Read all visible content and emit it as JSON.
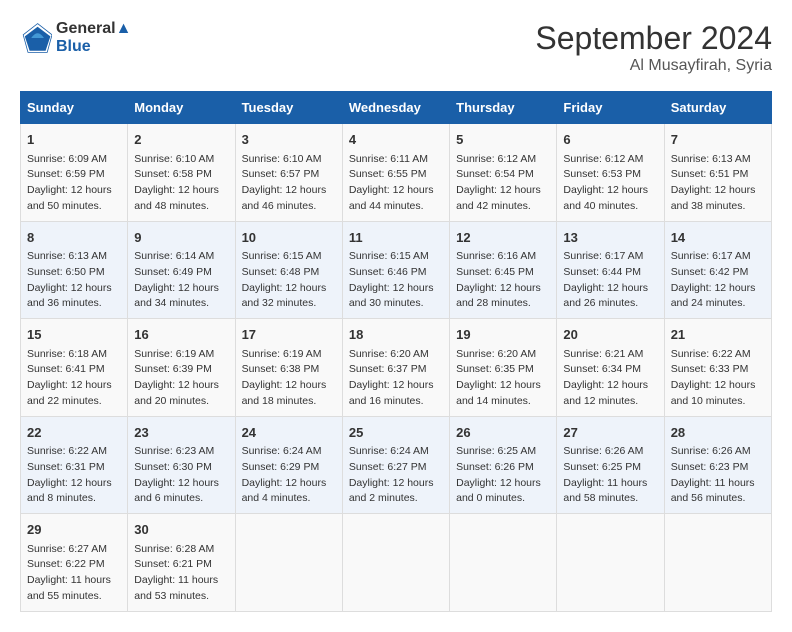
{
  "header": {
    "logo_line1": "General",
    "logo_line2": "Blue",
    "month": "September 2024",
    "location": "Al Musayfirah, Syria"
  },
  "days_of_week": [
    "Sunday",
    "Monday",
    "Tuesday",
    "Wednesday",
    "Thursday",
    "Friday",
    "Saturday"
  ],
  "weeks": [
    [
      {
        "day": "1",
        "lines": [
          "Sunrise: 6:09 AM",
          "Sunset: 6:59 PM",
          "Daylight: 12 hours",
          "and 50 minutes."
        ]
      },
      {
        "day": "2",
        "lines": [
          "Sunrise: 6:10 AM",
          "Sunset: 6:58 PM",
          "Daylight: 12 hours",
          "and 48 minutes."
        ]
      },
      {
        "day": "3",
        "lines": [
          "Sunrise: 6:10 AM",
          "Sunset: 6:57 PM",
          "Daylight: 12 hours",
          "and 46 minutes."
        ]
      },
      {
        "day": "4",
        "lines": [
          "Sunrise: 6:11 AM",
          "Sunset: 6:55 PM",
          "Daylight: 12 hours",
          "and 44 minutes."
        ]
      },
      {
        "day": "5",
        "lines": [
          "Sunrise: 6:12 AM",
          "Sunset: 6:54 PM",
          "Daylight: 12 hours",
          "and 42 minutes."
        ]
      },
      {
        "day": "6",
        "lines": [
          "Sunrise: 6:12 AM",
          "Sunset: 6:53 PM",
          "Daylight: 12 hours",
          "and 40 minutes."
        ]
      },
      {
        "day": "7",
        "lines": [
          "Sunrise: 6:13 AM",
          "Sunset: 6:51 PM",
          "Daylight: 12 hours",
          "and 38 minutes."
        ]
      }
    ],
    [
      {
        "day": "8",
        "lines": [
          "Sunrise: 6:13 AM",
          "Sunset: 6:50 PM",
          "Daylight: 12 hours",
          "and 36 minutes."
        ]
      },
      {
        "day": "9",
        "lines": [
          "Sunrise: 6:14 AM",
          "Sunset: 6:49 PM",
          "Daylight: 12 hours",
          "and 34 minutes."
        ]
      },
      {
        "day": "10",
        "lines": [
          "Sunrise: 6:15 AM",
          "Sunset: 6:48 PM",
          "Daylight: 12 hours",
          "and 32 minutes."
        ]
      },
      {
        "day": "11",
        "lines": [
          "Sunrise: 6:15 AM",
          "Sunset: 6:46 PM",
          "Daylight: 12 hours",
          "and 30 minutes."
        ]
      },
      {
        "day": "12",
        "lines": [
          "Sunrise: 6:16 AM",
          "Sunset: 6:45 PM",
          "Daylight: 12 hours",
          "and 28 minutes."
        ]
      },
      {
        "day": "13",
        "lines": [
          "Sunrise: 6:17 AM",
          "Sunset: 6:44 PM",
          "Daylight: 12 hours",
          "and 26 minutes."
        ]
      },
      {
        "day": "14",
        "lines": [
          "Sunrise: 6:17 AM",
          "Sunset: 6:42 PM",
          "Daylight: 12 hours",
          "and 24 minutes."
        ]
      }
    ],
    [
      {
        "day": "15",
        "lines": [
          "Sunrise: 6:18 AM",
          "Sunset: 6:41 PM",
          "Daylight: 12 hours",
          "and 22 minutes."
        ]
      },
      {
        "day": "16",
        "lines": [
          "Sunrise: 6:19 AM",
          "Sunset: 6:39 PM",
          "Daylight: 12 hours",
          "and 20 minutes."
        ]
      },
      {
        "day": "17",
        "lines": [
          "Sunrise: 6:19 AM",
          "Sunset: 6:38 PM",
          "Daylight: 12 hours",
          "and 18 minutes."
        ]
      },
      {
        "day": "18",
        "lines": [
          "Sunrise: 6:20 AM",
          "Sunset: 6:37 PM",
          "Daylight: 12 hours",
          "and 16 minutes."
        ]
      },
      {
        "day": "19",
        "lines": [
          "Sunrise: 6:20 AM",
          "Sunset: 6:35 PM",
          "Daylight: 12 hours",
          "and 14 minutes."
        ]
      },
      {
        "day": "20",
        "lines": [
          "Sunrise: 6:21 AM",
          "Sunset: 6:34 PM",
          "Daylight: 12 hours",
          "and 12 minutes."
        ]
      },
      {
        "day": "21",
        "lines": [
          "Sunrise: 6:22 AM",
          "Sunset: 6:33 PM",
          "Daylight: 12 hours",
          "and 10 minutes."
        ]
      }
    ],
    [
      {
        "day": "22",
        "lines": [
          "Sunrise: 6:22 AM",
          "Sunset: 6:31 PM",
          "Daylight: 12 hours",
          "and 8 minutes."
        ]
      },
      {
        "day": "23",
        "lines": [
          "Sunrise: 6:23 AM",
          "Sunset: 6:30 PM",
          "Daylight: 12 hours",
          "and 6 minutes."
        ]
      },
      {
        "day": "24",
        "lines": [
          "Sunrise: 6:24 AM",
          "Sunset: 6:29 PM",
          "Daylight: 12 hours",
          "and 4 minutes."
        ]
      },
      {
        "day": "25",
        "lines": [
          "Sunrise: 6:24 AM",
          "Sunset: 6:27 PM",
          "Daylight: 12 hours",
          "and 2 minutes."
        ]
      },
      {
        "day": "26",
        "lines": [
          "Sunrise: 6:25 AM",
          "Sunset: 6:26 PM",
          "Daylight: 12 hours",
          "and 0 minutes."
        ]
      },
      {
        "day": "27",
        "lines": [
          "Sunrise: 6:26 AM",
          "Sunset: 6:25 PM",
          "Daylight: 11 hours",
          "and 58 minutes."
        ]
      },
      {
        "day": "28",
        "lines": [
          "Sunrise: 6:26 AM",
          "Sunset: 6:23 PM",
          "Daylight: 11 hours",
          "and 56 minutes."
        ]
      }
    ],
    [
      {
        "day": "29",
        "lines": [
          "Sunrise: 6:27 AM",
          "Sunset: 6:22 PM",
          "Daylight: 11 hours",
          "and 55 minutes."
        ]
      },
      {
        "day": "30",
        "lines": [
          "Sunrise: 6:28 AM",
          "Sunset: 6:21 PM",
          "Daylight: 11 hours",
          "and 53 minutes."
        ]
      },
      {
        "day": "",
        "lines": []
      },
      {
        "day": "",
        "lines": []
      },
      {
        "day": "",
        "lines": []
      },
      {
        "day": "",
        "lines": []
      },
      {
        "day": "",
        "lines": []
      }
    ]
  ]
}
